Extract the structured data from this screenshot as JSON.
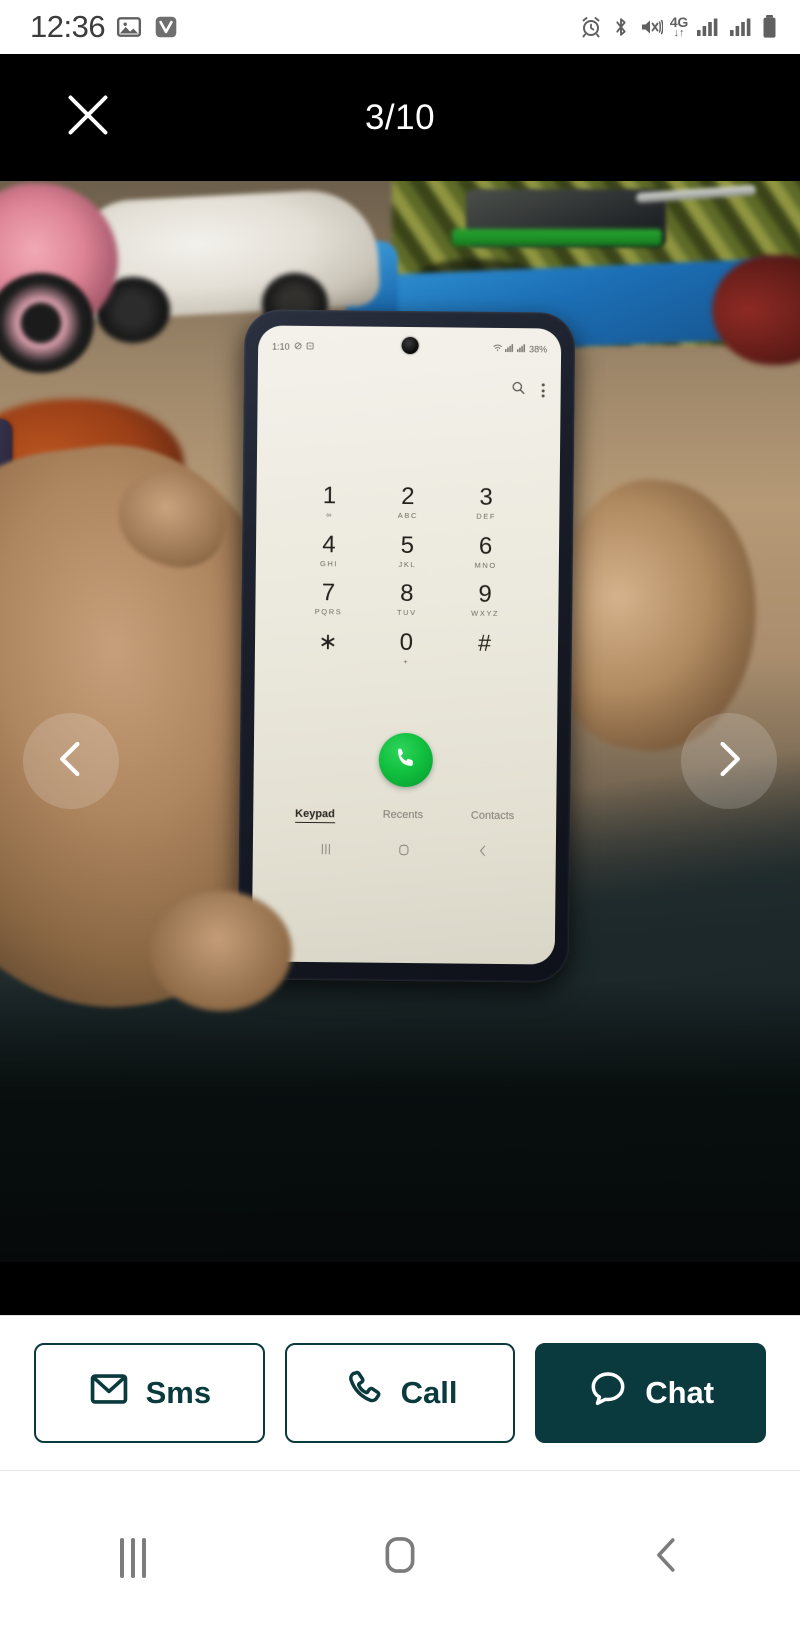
{
  "os_status_bar": {
    "clock": "12:36",
    "left_icons": [
      "image-icon",
      "v-app-icon"
    ],
    "right_icons": [
      "alarm-icon",
      "bluetooth-icon",
      "vibrate-mute-icon",
      "mobile-data-icon",
      "signal-bars-sim1-icon",
      "signal-bars-sim2-icon",
      "battery-icon"
    ],
    "network_label": "4G",
    "network_arrows": "↓↑"
  },
  "gallery_header": {
    "close_label": "close-icon",
    "counter": "3/10",
    "current_index": 3,
    "total": 10,
    "background": "#000000"
  },
  "viewer": {
    "prev_label": "‹",
    "next_label": "›",
    "scene_description": "Hand holding a dark-cased smartphone over dark denim lap; background shows a white toy ride-on car, pink toy, blue plastic board and green camo mat on a tiled floor."
  },
  "inner_phone": {
    "status": {
      "time": "1:10",
      "left_icons": [
        "mute-icon",
        "screenshot-icon"
      ],
      "right_icons": [
        "wifi-icon",
        "signal-icon",
        "signal-icon"
      ],
      "battery": "38%"
    },
    "toolbar": {
      "search_label": "search-icon",
      "menu_label": "overflow-menu-icon"
    },
    "keys": [
      {
        "num": "1",
        "sub": "∞"
      },
      {
        "num": "2",
        "sub": "ABC"
      },
      {
        "num": "3",
        "sub": "DEF"
      },
      {
        "num": "4",
        "sub": "GHI"
      },
      {
        "num": "5",
        "sub": "JKL"
      },
      {
        "num": "6",
        "sub": "MNO"
      },
      {
        "num": "7",
        "sub": "PQRS"
      },
      {
        "num": "8",
        "sub": "TUV"
      },
      {
        "num": "9",
        "sub": "WXYZ"
      },
      {
        "num": "∗",
        "sub": ""
      },
      {
        "num": "0",
        "sub": "+"
      },
      {
        "num": "#",
        "sub": ""
      }
    ],
    "call_button_label": "call-icon",
    "call_button_color": "#12c13f",
    "tabs": [
      {
        "label": "Keypad",
        "active": true
      },
      {
        "label": "Recents",
        "active": false
      },
      {
        "label": "Contacts",
        "active": false
      }
    ],
    "nav": [
      "recents-icon",
      "home-icon",
      "back-icon"
    ]
  },
  "action_bar": {
    "accent_color": "#0a3a3d",
    "buttons": [
      {
        "label": "Sms",
        "icon": "envelope-icon",
        "style": "outline"
      },
      {
        "label": "Call",
        "icon": "phone-handset-icon",
        "style": "outline"
      },
      {
        "label": "Chat",
        "icon": "speech-bubble-icon",
        "style": "filled"
      }
    ]
  },
  "system_nav": {
    "recents_label": "recents-icon",
    "home_label": "home-icon",
    "back_label": "back-icon"
  }
}
